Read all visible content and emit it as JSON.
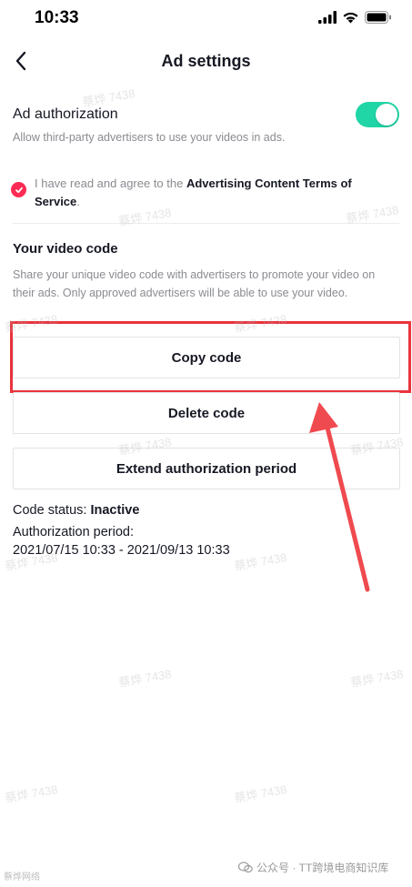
{
  "status_bar": {
    "time": "10:33"
  },
  "nav": {
    "title": "Ad settings"
  },
  "ad_authorization": {
    "title": "Ad authorization",
    "subtitle": "Allow third-party advertisers to use your videos in ads.",
    "toggle_on": true
  },
  "agreement": {
    "prefix": "I have read and agree to the ",
    "link": "Advertising Content Terms of Service",
    "suffix": ".",
    "checked": true
  },
  "video_code": {
    "title": "Your video code",
    "description": "Share your unique video code with advertisers to promote your video on their ads. Only approved advertisers will be able to use your video."
  },
  "buttons": {
    "copy": "Copy code",
    "delete": "Delete code",
    "extend": "Extend authorization period"
  },
  "code_status": {
    "label": "Code status: ",
    "value": "Inactive"
  },
  "authorization_period": {
    "label": "Authorization period:",
    "value": "2021/07/15 10:33 - 2021/09/13 10:33"
  },
  "watermark": "蔡烨 7438",
  "footer": {
    "left": "蔡烨网络",
    "right": "公众号 · TT跨境电商知识库"
  },
  "colors": {
    "accent": "#fe2c55",
    "toggle": "#20d5a6",
    "highlight": "#e9333d"
  }
}
